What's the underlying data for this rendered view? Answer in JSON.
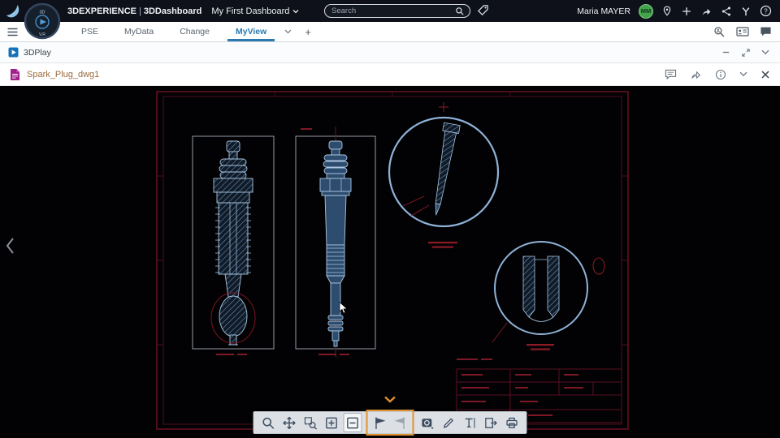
{
  "topbar": {
    "brand": "3DEXPERIENCE",
    "separator": "|",
    "app_name": "3DDashboard",
    "dashboard_name": "My First Dashboard",
    "search_placeholder": "Search",
    "user_name": "Maria MAYER",
    "avatar_initials": "MM"
  },
  "tabbar": {
    "tabs": [
      {
        "label": "PSE"
      },
      {
        "label": "MyData"
      },
      {
        "label": "Change"
      },
      {
        "label": "MyView"
      }
    ],
    "active_tab": "MyView",
    "add_tab_label": "+"
  },
  "widget": {
    "title": "3DPlay"
  },
  "document": {
    "title": "Spark_Plug_dwg1"
  },
  "viewer_toolbar": {
    "tools": [
      "zoom",
      "pan",
      "zoom-window",
      "zoom-in",
      "zoom-out",
      "previous-sheet",
      "next-sheet",
      "render-options",
      "draw",
      "text",
      "export-2d",
      "print"
    ],
    "active_tool": "zoom-out",
    "disabled_tool": "next-sheet",
    "highlighted_tools": [
      "previous-sheet",
      "next-sheet"
    ]
  },
  "colors": {
    "topbar_bg": "#0e1119",
    "active_tab_blue": "#2a7ab0",
    "doc_title_brown": "#9b6a3c",
    "sheet_border_red": "#4f0d1b",
    "dimension_red": "#8c1b26",
    "plug_blue": "#a9c6e4",
    "highlight_orange": "#e0922f",
    "avatar_green": "#43a24a"
  }
}
